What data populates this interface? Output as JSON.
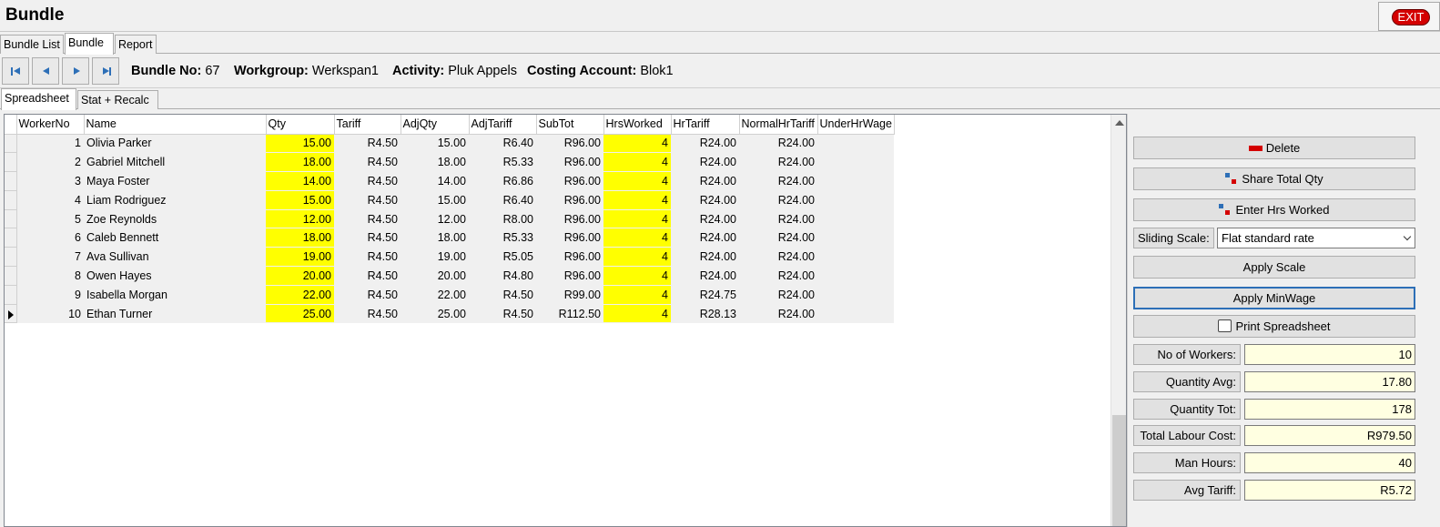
{
  "window": {
    "title": "Bundle",
    "exit_label": "EXIT"
  },
  "top_tabs": [
    {
      "label": "Bundle List",
      "active": false
    },
    {
      "label": "Bundle",
      "active": true
    },
    {
      "label": "Report",
      "active": false
    }
  ],
  "nav": {
    "bundle_no_label": "Bundle No:",
    "bundle_no": "67",
    "workgroup_label": "Workgroup:",
    "workgroup": "Werkspan1",
    "activity_label": "Activity:",
    "activity": "Pluk Appels",
    "costing_label": "Costing Account:",
    "costing": "Blok1"
  },
  "sub_tabs": [
    {
      "label": "Spreadsheet",
      "active": true
    },
    {
      "label": "Stat + Recalc",
      "active": false
    }
  ],
  "grid": {
    "columns": [
      "WorkerNo",
      "Name",
      "Qty",
      "Tariff",
      "AdjQty",
      "AdjTariff",
      "SubTot",
      "HrsWorked",
      "HrTariff",
      "NormalHrTariff",
      "UnderHrWage"
    ],
    "rows": [
      [
        "1",
        "Olivia Parker",
        "15.00",
        "R4.50",
        "15.00",
        "R6.40",
        "R96.00",
        "4",
        "R24.00",
        "R24.00",
        ""
      ],
      [
        "2",
        "Gabriel Mitchell",
        "18.00",
        "R4.50",
        "18.00",
        "R5.33",
        "R96.00",
        "4",
        "R24.00",
        "R24.00",
        ""
      ],
      [
        "3",
        "Maya Foster",
        "14.00",
        "R4.50",
        "14.00",
        "R6.86",
        "R96.00",
        "4",
        "R24.00",
        "R24.00",
        ""
      ],
      [
        "4",
        "Liam Rodriguez",
        "15.00",
        "R4.50",
        "15.00",
        "R6.40",
        "R96.00",
        "4",
        "R24.00",
        "R24.00",
        ""
      ],
      [
        "5",
        "Zoe Reynolds",
        "12.00",
        "R4.50",
        "12.00",
        "R8.00",
        "R96.00",
        "4",
        "R24.00",
        "R24.00",
        ""
      ],
      [
        "6",
        "Caleb Bennett",
        "18.00",
        "R4.50",
        "18.00",
        "R5.33",
        "R96.00",
        "4",
        "R24.00",
        "R24.00",
        ""
      ],
      [
        "7",
        "Ava Sullivan",
        "19.00",
        "R4.50",
        "19.00",
        "R5.05",
        "R96.00",
        "4",
        "R24.00",
        "R24.00",
        ""
      ],
      [
        "8",
        "Owen Hayes",
        "20.00",
        "R4.50",
        "20.00",
        "R4.80",
        "R96.00",
        "4",
        "R24.00",
        "R24.00",
        ""
      ],
      [
        "9",
        "Isabella Morgan",
        "22.00",
        "R4.50",
        "22.00",
        "R4.50",
        "R99.00",
        "4",
        "R24.75",
        "R24.00",
        ""
      ],
      [
        "10",
        "Ethan Turner",
        "25.00",
        "R4.50",
        "25.00",
        "R4.50",
        "R112.50",
        "4",
        "R28.13",
        "R24.00",
        ""
      ]
    ],
    "current_row": 9,
    "highlight_color": "#ffff00"
  },
  "panel": {
    "delete_label": "Delete",
    "share_label": "Share Total Qty",
    "enter_hrs_label": "Enter Hrs Worked",
    "sliding_scale_label": "Sliding Scale:",
    "sliding_scale_value": "Flat standard rate",
    "apply_scale_label": "Apply Scale",
    "apply_minwage_label": "Apply MinWage",
    "print_label": "Print Spreadsheet",
    "stats": [
      {
        "label": "No of Workers:",
        "value": "10"
      },
      {
        "label": "Quantity Avg:",
        "value": "17.80"
      },
      {
        "label": "Quantity Tot:",
        "value": "178"
      },
      {
        "label": "Total Labour Cost:",
        "value": "R979.50"
      },
      {
        "label": "Man Hours:",
        "value": "40"
      },
      {
        "label": "Avg Tariff:",
        "value": "R5.72"
      }
    ]
  },
  "icons": [
    "first-record-icon",
    "previous-record-icon",
    "next-record-icon",
    "last-record-icon",
    "delete-icon",
    "share-icon",
    "enter-hours-icon",
    "printer-icon",
    "row-pointer-icon",
    "chevron-down-icon",
    "scroll-up-arrow-icon"
  ]
}
